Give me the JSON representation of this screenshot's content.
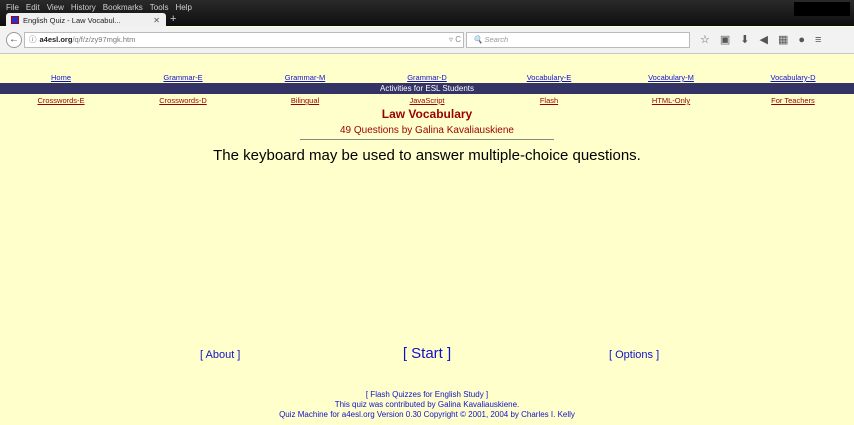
{
  "browser": {
    "menu": [
      "File",
      "Edit",
      "View",
      "History",
      "Bookmarks",
      "Tools",
      "Help"
    ],
    "tab_title": "English Quiz - Law Vocabul...",
    "url_domain": "a4esl.org",
    "url_path": "/q/f/z/zy97mgk.htm",
    "search_placeholder": "Search"
  },
  "nav_top": [
    "Home",
    "Grammar-E",
    "Grammar-M",
    "Grammar-D",
    "Vocabulary-E",
    "Vocabulary-M",
    "Vocabulary-D"
  ],
  "banner": "Activities for ESL Students",
  "nav_bottom": [
    "Crosswords-E",
    "Crosswords-D",
    "Bilingual",
    "JavaScript",
    "Flash",
    "HTML-Only",
    "For Teachers"
  ],
  "quiz": {
    "title": "Law Vocabulary",
    "subtitle": "49 Questions by Galina Kavaliauskiene",
    "instruction": "The keyboard may be used to answer multiple-choice questions.",
    "about": "[ About ]",
    "start": "[ Start ]",
    "options": "[ Options ]"
  },
  "footer": {
    "flash": "[ Flash Quizzes for English Study ]",
    "credit": "This quiz was contributed by Galina Kavaliauskiene.",
    "copyright": "Quiz Machine for a4esl.org Version 0.30    Copyright © 2001, 2004 by Charles I. Kelly"
  },
  "colors": {
    "page_bg": "#FFFFCC",
    "banner_bg": "#333366",
    "link_blue": "#1111cc",
    "heading_red": "#990000"
  }
}
